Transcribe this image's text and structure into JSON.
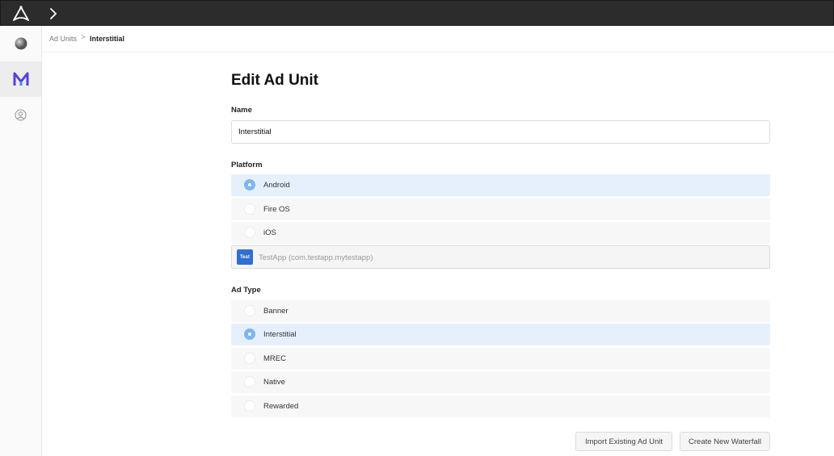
{
  "breadcrumb": {
    "root": "Ad Units",
    "separator": ">",
    "current": "Interstitial"
  },
  "page": {
    "title": "Edit Ad Unit"
  },
  "name_field": {
    "label": "Name",
    "value": "Interstitial"
  },
  "platform": {
    "label": "Platform",
    "options": [
      {
        "label": "Android",
        "selected": true
      },
      {
        "label": "Fire OS",
        "selected": false
      },
      {
        "label": "iOS",
        "selected": false
      }
    ],
    "app": {
      "badge": "Test",
      "label": "TestApp (com.testapp.mytestapp)"
    }
  },
  "ad_type": {
    "label": "Ad Type",
    "options": [
      {
        "label": "Banner",
        "selected": false
      },
      {
        "label": "Interstitial",
        "selected": true
      },
      {
        "label": "MREC",
        "selected": false
      },
      {
        "label": "Native",
        "selected": false
      },
      {
        "label": "Rewarded",
        "selected": false
      }
    ]
  },
  "actions": {
    "import_label": "Import Existing Ad Unit",
    "create_label": "Create New Waterfall"
  },
  "colors": {
    "topbar": "#2c2c2c",
    "selected_row": "#e6f0fd",
    "radio_on": "#7fb6f2",
    "app_badge": "#2f6fd0"
  }
}
